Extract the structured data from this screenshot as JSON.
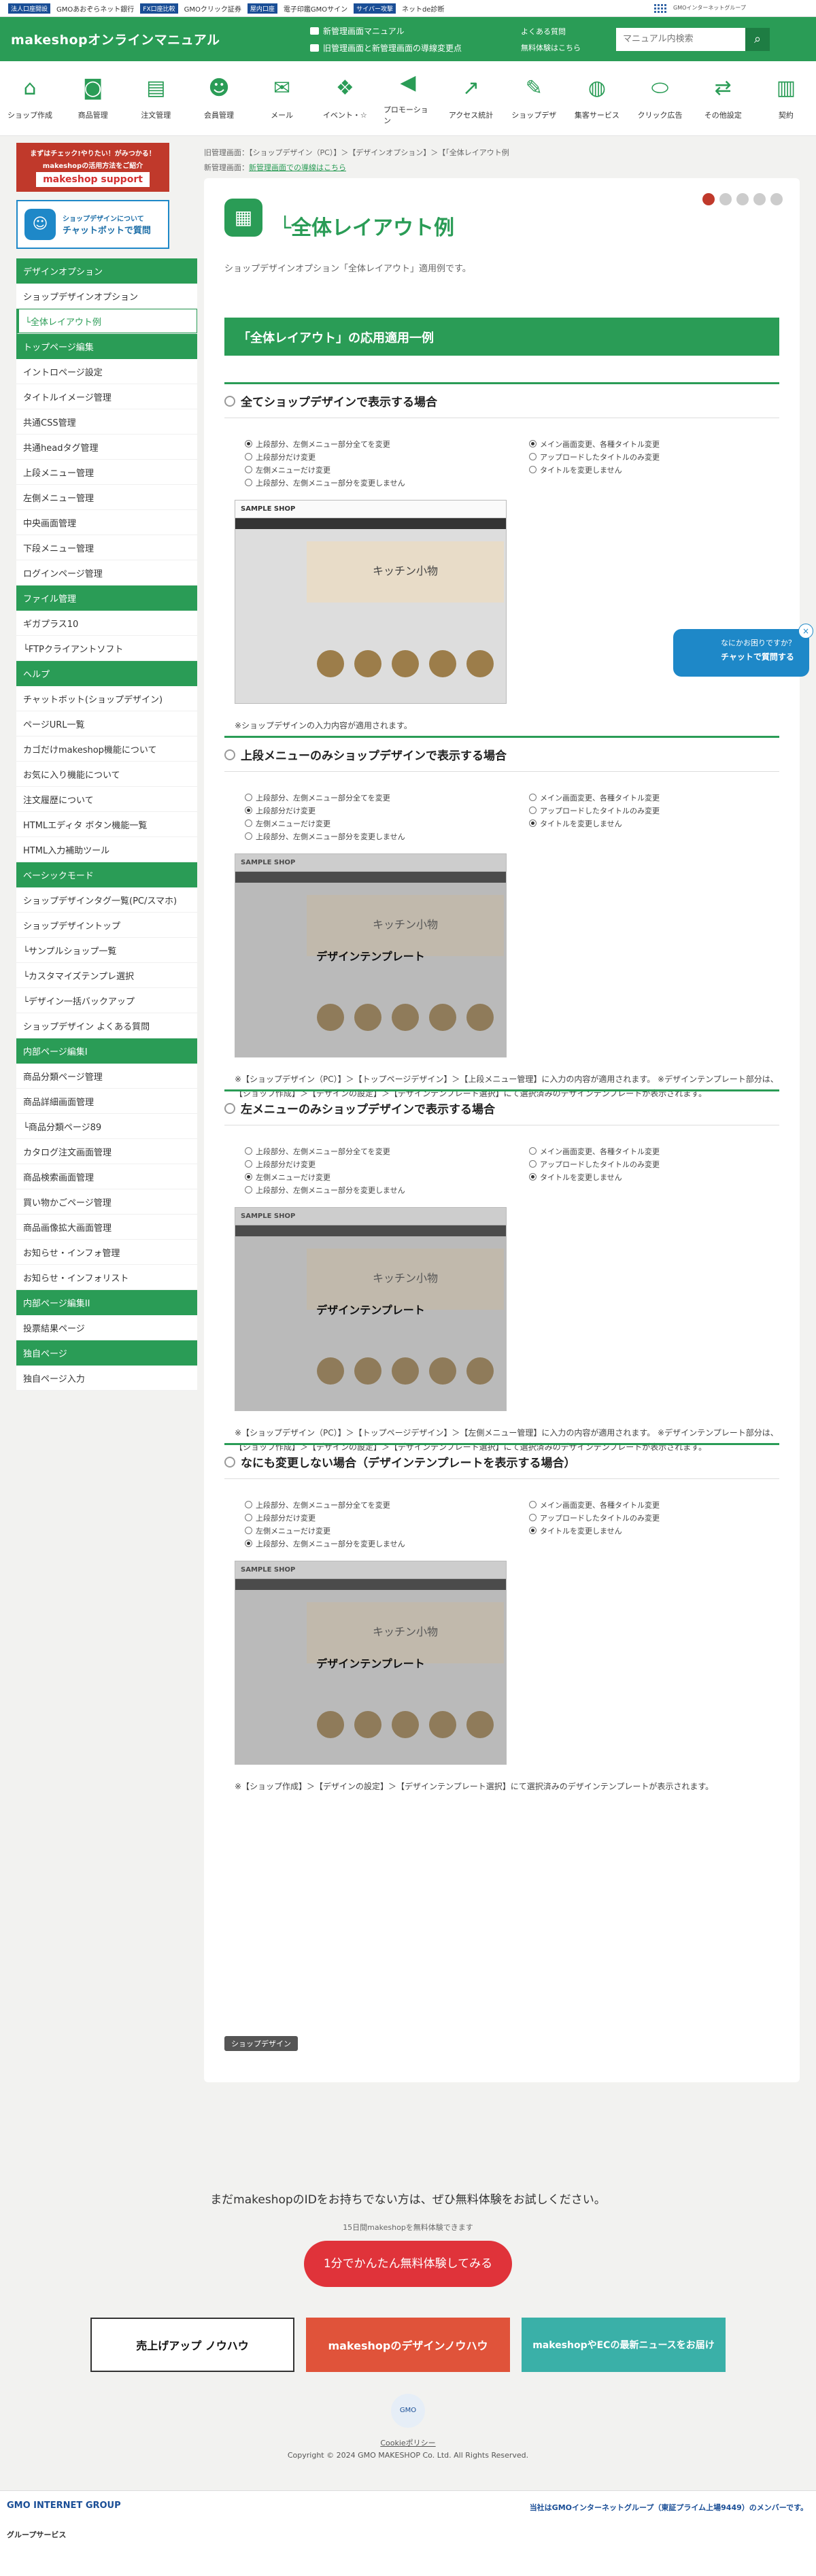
{
  "gmo_bar": {
    "links": [
      "法人口座開設",
      "GMOあおぞらネット銀行",
      "FX口座比較",
      "GMOクリック証券",
      "屋内口座",
      "電子印鑑GMOサイン",
      "サイバー攻撃",
      "ネットde診断"
    ],
    "brand": "GMOインターネットグループ"
  },
  "header": {
    "logo": "makeshopオンラインマニュアル",
    "note1": "新管理画面マニュアル",
    "note2": "旧管理画面と新管理画面の導線変更点",
    "faq": "よくある質問",
    "trial": "無料体験はこちら",
    "search_placeholder": "マニュアル内検索"
  },
  "gnav": [
    {
      "label": "ショップ作成",
      "icon": "shop-icon"
    },
    {
      "label": "商品管理",
      "icon": "bag-icon"
    },
    {
      "label": "注文管理",
      "icon": "clipboard-icon"
    },
    {
      "label": "会員管理",
      "icon": "users-icon"
    },
    {
      "label": "メール",
      "icon": "mail-icon"
    },
    {
      "label": "イベント・☆",
      "icon": "gift-icon"
    },
    {
      "label": "プロモーション",
      "icon": "megaphone-icon"
    },
    {
      "label": "アクセス統計",
      "icon": "chart-icon"
    },
    {
      "label": "ショップデザ",
      "icon": "palette-icon"
    },
    {
      "label": "集客サービス",
      "icon": "globe-icon"
    },
    {
      "label": "クリック広告",
      "icon": "mouse-icon"
    },
    {
      "label": "その他設定",
      "icon": "swap-icon"
    },
    {
      "label": "契約",
      "icon": "contract-icon"
    }
  ],
  "crumbs": {
    "path": "旧管理画面：【ショップデザイン（PC）】＞【デザインオプション】＞【「全体レイアウト例",
    "new_label": "新管理画面：",
    "new_link": "新管理画面での導線はこちら"
  },
  "banner1": {
    "line1": "まずはチェック!やりたい！がみつかる！",
    "line2": "makeshopの活用方法をご紹介",
    "logo": "makeshop support"
  },
  "banner2": {
    "line1": "ショップデザインについて",
    "line2": "チャットボットで質問"
  },
  "sidebar": [
    {
      "type": "h",
      "label": "デザインオプション"
    },
    {
      "type": "i",
      "label": "ショップデザインオプション"
    },
    {
      "type": "a",
      "label": "└全体レイアウト例"
    },
    {
      "type": "h",
      "label": "トップページ編集"
    },
    {
      "type": "i",
      "label": "イントロページ設定"
    },
    {
      "type": "i",
      "label": "タイトルイメージ管理"
    },
    {
      "type": "i",
      "label": "共通CSS管理"
    },
    {
      "type": "i",
      "label": "共通headタグ管理"
    },
    {
      "type": "i",
      "label": "上段メニュー管理"
    },
    {
      "type": "i",
      "label": "左側メニュー管理"
    },
    {
      "type": "i",
      "label": "中央画面管理"
    },
    {
      "type": "i",
      "label": "下段メニュー管理"
    },
    {
      "type": "i",
      "label": "ログインページ管理"
    },
    {
      "type": "h",
      "label": "ファイル管理"
    },
    {
      "type": "i",
      "label": "ギガプラス10"
    },
    {
      "type": "i",
      "label": "└FTPクライアントソフト"
    },
    {
      "type": "h",
      "label": "ヘルプ"
    },
    {
      "type": "i",
      "label": "チャットボット(ショップデザイン)"
    },
    {
      "type": "i",
      "label": "ページURL一覧"
    },
    {
      "type": "i",
      "label": "カゴだけmakeshop機能について"
    },
    {
      "type": "i",
      "label": "お気に入り機能について"
    },
    {
      "type": "i",
      "label": "注文履歴について"
    },
    {
      "type": "i",
      "label": "HTMLエディタ ボタン機能一覧"
    },
    {
      "type": "i",
      "label": "HTML入力補助ツール"
    },
    {
      "type": "h",
      "label": "ベーシックモード"
    },
    {
      "type": "i",
      "label": "ショップデザインタグ一覧(PC/スマホ)"
    },
    {
      "type": "i",
      "label": "ショップデザイントップ"
    },
    {
      "type": "i",
      "label": "└サンプルショップ一覧"
    },
    {
      "type": "i",
      "label": "└カスタマイズテンプレ選択"
    },
    {
      "type": "i",
      "label": "└デザイン一括バックアップ"
    },
    {
      "type": "i",
      "label": "ショップデザイン よくある質問"
    },
    {
      "type": "h",
      "label": "内部ページ編集I"
    },
    {
      "type": "i",
      "label": "商品分類ページ管理"
    },
    {
      "type": "i",
      "label": "商品詳細画面管理"
    },
    {
      "type": "i",
      "label": "└商品分類ページ89"
    },
    {
      "type": "i",
      "label": "カタログ注文画面管理"
    },
    {
      "type": "i",
      "label": "商品検索画面管理"
    },
    {
      "type": "i",
      "label": "買い物かごページ管理"
    },
    {
      "type": "i",
      "label": "商品画像拡大画面管理"
    },
    {
      "type": "i",
      "label": "お知らせ・インフォ管理"
    },
    {
      "type": "i",
      "label": "お知らせ・インフォリスト"
    },
    {
      "type": "h",
      "label": "内部ページ編集II"
    },
    {
      "type": "i",
      "label": "投票結果ページ"
    },
    {
      "type": "h",
      "label": "独自ページ"
    },
    {
      "type": "i",
      "label": "独自ページ入力"
    }
  ],
  "main": {
    "title": "└全体レイアウト例",
    "lead": "ショップデザインオプション「全体レイアウト」適用例です。",
    "band": "「全体レイアウト」の応用適用一例",
    "radio_left": [
      "上段部分、左側メニュー部分全てを変更",
      "上段部分だけ変更",
      "左側メニューだけ変更",
      "上段部分、左側メニュー部分を変更しません"
    ],
    "radio_right": [
      "メイン画面変更、各種タイトル変更",
      "アップロードしたタイトルのみ変更",
      "タイトルを変更しません"
    ],
    "shop_name": "SAMPLE SHOP",
    "hero": "キッチン小物",
    "overlay_text": "デザインテンプレート",
    "sections": [
      {
        "title": "全てショップデザインで表示する場合",
        "left_on": 0,
        "right_on": 0,
        "overlay": false,
        "note": "※ショップデザインの入力内容が適用されます。"
      },
      {
        "title": "上段メニューのみショップデザインで表示する場合",
        "left_on": 1,
        "right_on": 2,
        "overlay": true,
        "note": "※【ショップデザイン（PC）】＞【トップページデザイン】＞【上段メニュー管理】に入力の内容が適用されます。 ※デザインテンプレート部分は、【ショップ作成】＞【デザインの設定】＞【デザインテンプレート選択】にて選択済みのデザインテンプレートが表示されます。"
      },
      {
        "title": "左メニューのみショップデザインで表示する場合",
        "left_on": 2,
        "right_on": 2,
        "overlay": true,
        "note": "※【ショップデザイン（PC）】＞【トップページデザイン】＞【左側メニュー管理】に入力の内容が適用されます。 ※デザインテンプレート部分は、【ショップ作成】＞【デザインの設定】＞【デザインテンプレート選択】にて選択済みのデザインテンプレートが表示されます。"
      },
      {
        "title": "なにも変更しない場合（デザインテンプレートを表示する場合）",
        "left_on": 3,
        "right_on": 2,
        "overlay": true,
        "note": "※【ショップ作成】＞【デザインの設定】＞【デザインテンプレート選択】にて選択済みのデザインテンプレートが表示されます。"
      }
    ],
    "tag": "ショップデザイン"
  },
  "float": {
    "line1": "なにかお困りですか？",
    "line2": "チャットで質問する"
  },
  "cta": {
    "text": "まだmakeshopのIDをお持ちでない方は、ぜひ無料体験をお試しください。",
    "sub": "15日間makeshopを無料体験できます",
    "button": "1分でかんたん無料体験してみる"
  },
  "promos": [
    {
      "label": "売上げアップ ノウハウ"
    },
    {
      "label": "makeshopのデザインノウハウ"
    },
    {
      "label": "makeshopやECの最新ニュースをお届け"
    }
  ],
  "footer": {
    "cookie": "Cookieポリシー",
    "copyright": "Copyright © 2024 GMO MAKESHOP Co. Ltd. All Rights Reserved.",
    "group": "GMO INTERNET GROUP",
    "member": "当社はGMOインターネットグループ（東証プライム上場9449）のメンバーです。",
    "services": "グループサービス"
  }
}
